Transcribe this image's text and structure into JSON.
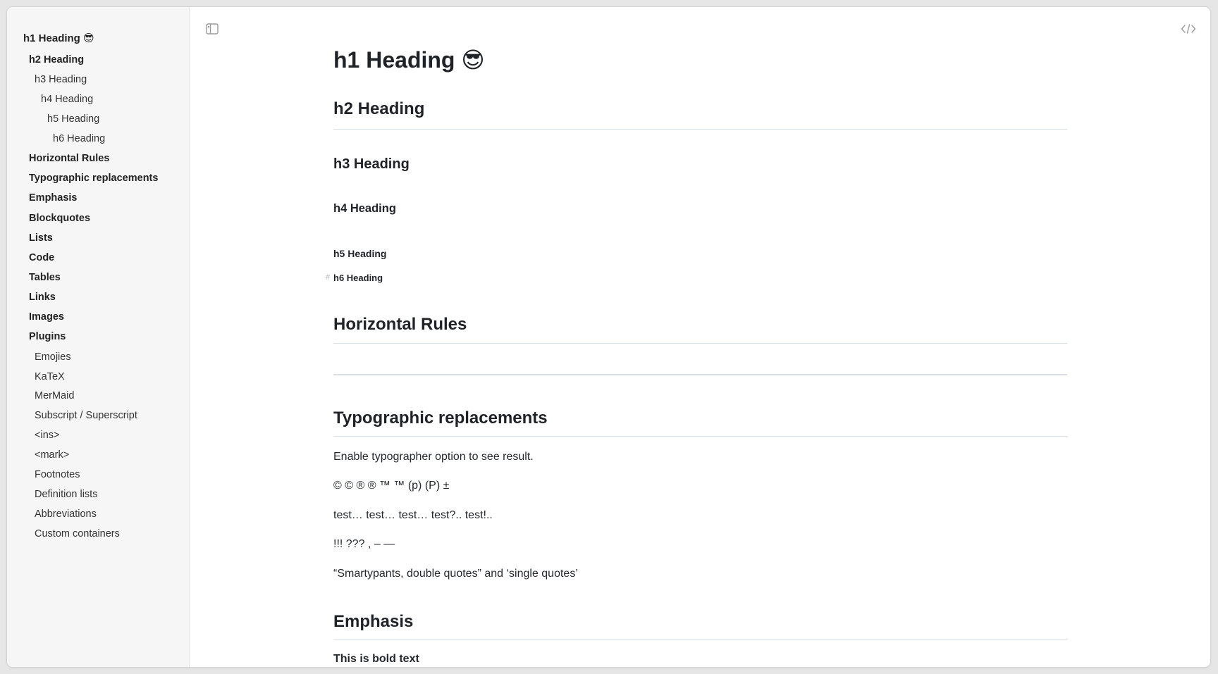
{
  "sidebar": {
    "items": [
      {
        "label": "h1 Heading 😎"
      },
      {
        "label": "h2 Heading"
      },
      {
        "label": "h3 Heading"
      },
      {
        "label": "h4 Heading"
      },
      {
        "label": "h5 Heading"
      },
      {
        "label": "h6 Heading"
      },
      {
        "label": "Horizontal Rules"
      },
      {
        "label": "Typographic replacements"
      },
      {
        "label": "Emphasis"
      },
      {
        "label": "Blockquotes"
      },
      {
        "label": "Lists"
      },
      {
        "label": "Code"
      },
      {
        "label": "Tables"
      },
      {
        "label": "Links"
      },
      {
        "label": "Images"
      },
      {
        "label": "Plugins"
      },
      {
        "label": "Emojies"
      },
      {
        "label": "KaTeX"
      },
      {
        "label": "MerMaid"
      },
      {
        "label": "Subscript / Superscript"
      },
      {
        "label": "<ins>"
      },
      {
        "label": "<mark>"
      },
      {
        "label": "Footnotes"
      },
      {
        "label": "Definition lists"
      },
      {
        "label": "Abbreviations"
      },
      {
        "label": "Custom containers"
      }
    ]
  },
  "toolbar": {
    "sidebar_toggle_icon": "sidebar-toggle-icon",
    "code_view_icon": "code-icon"
  },
  "document": {
    "h1": "h1 Heading 😎",
    "h2": "h2 Heading",
    "h3": "h3 Heading",
    "h4": "h4 Heading",
    "h5": "h5 Heading",
    "h6_anchor": "#",
    "h6": "h6 Heading",
    "horizontal_rules": "Horizontal Rules",
    "typographic": "Typographic replacements",
    "typo_p1": "Enable typographer option to see result.",
    "typo_p2": "© © ® ® ™ ™ (p) (P) ±",
    "typo_p3": "test… test… test… test?.. test!..",
    "typo_p4": "!!! ??? , – —",
    "typo_p5": "“Smartypants, double quotes” and ‘single quotes’",
    "emphasis": "Emphasis",
    "bold_text": "This is bold text"
  },
  "colors": {
    "sidebar_bg": "#f6f6f6",
    "rule": "#d8dee4",
    "text": "#24292f"
  }
}
